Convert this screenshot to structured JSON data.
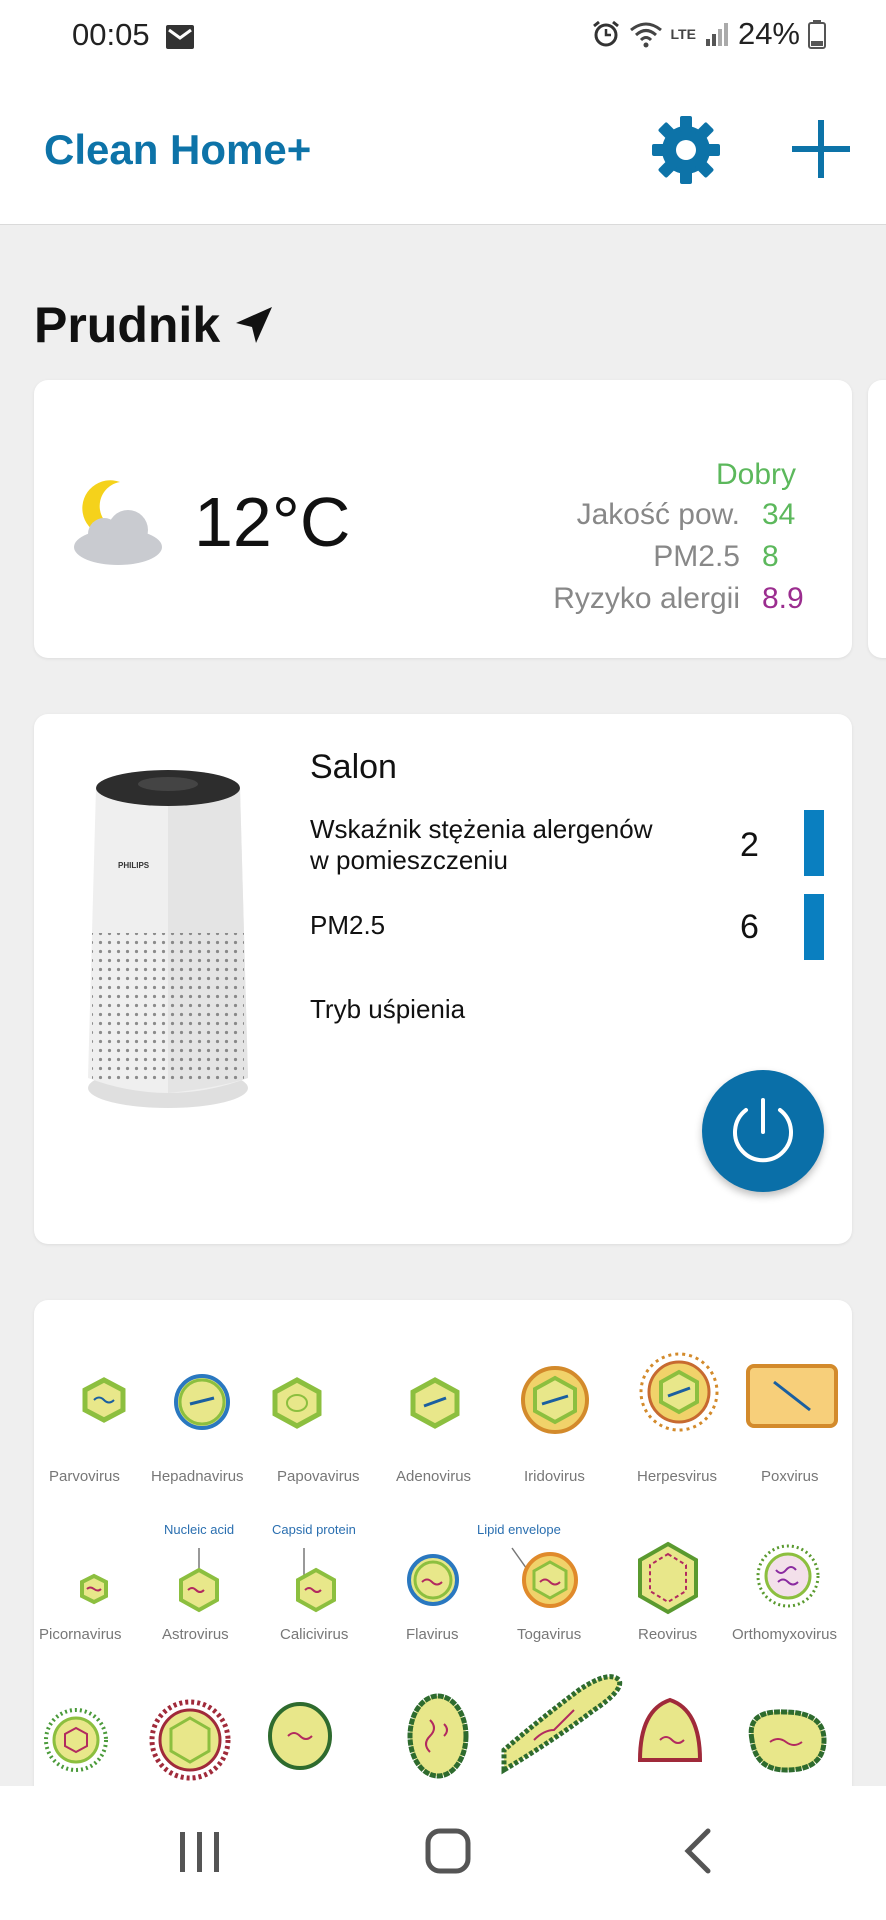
{
  "status_bar": {
    "time": "00:05",
    "network": "LTE",
    "battery": "24%"
  },
  "app": {
    "title": "Clean Home+"
  },
  "location": {
    "name": "Prudnik"
  },
  "weather": {
    "temperature": "12°C",
    "quality_label": "Dobry",
    "rows": [
      {
        "label": "Jakość pow.",
        "value": "34",
        "color": "#5cb85c"
      },
      {
        "label": "PM2.5",
        "value": "8",
        "color": "#5cb85c"
      },
      {
        "label": "Ryzyko alergii",
        "value": "8.9",
        "color": "#9b2d8f"
      }
    ]
  },
  "device": {
    "brand": "PHILIPS",
    "name": "Salon",
    "allergen_label": "Wskaźnik stężenia alergenów w pomieszczeniu",
    "allergen_value": "2",
    "pm25_label": "PM2.5",
    "pm25_value": "6",
    "mode": "Tryb uśpienia",
    "accent": "#0a6fa8"
  },
  "virus_chart": {
    "row1": [
      "Parvovirus",
      "Hepadnavirus",
      "Papovavirus",
      "Adenovirus",
      "Iridovirus",
      "Herpesvirus",
      "Poxvirus"
    ],
    "row2": [
      "Picornavirus",
      "Astrovirus",
      "Calicivirus",
      "Flavirus",
      "Togavirus",
      "Reovirus",
      "Orthomyxovirus"
    ],
    "annotations": [
      "Nucleic acid",
      "Capsid protein",
      "Lipid envelope"
    ]
  }
}
